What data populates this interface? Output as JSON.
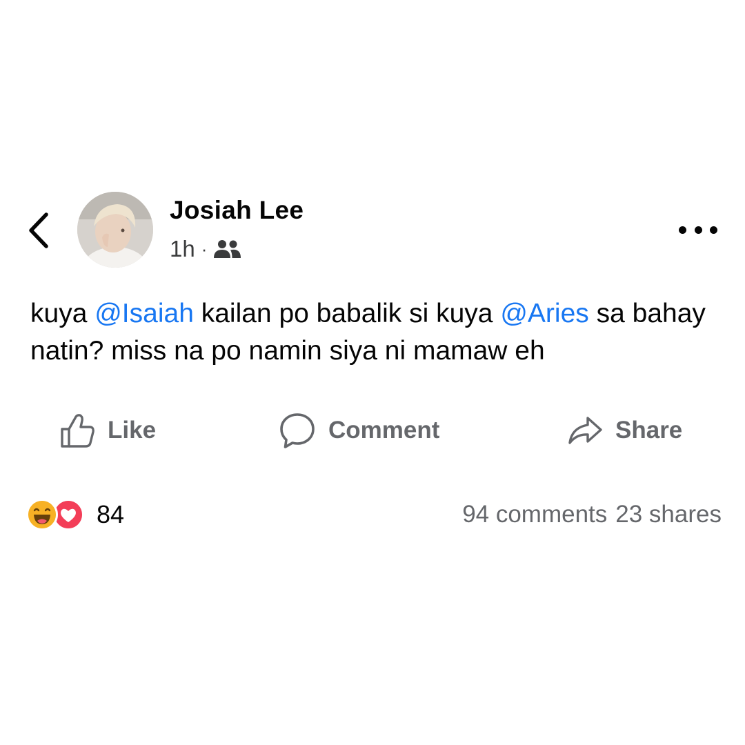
{
  "post": {
    "author": "Josiah Lee",
    "time": "1h",
    "separator": "·",
    "audience_icon": "friends-icon",
    "text_parts": {
      "t1": "kuya ",
      "m1": "@Isaiah",
      "t2": " kailan po babalik si kuya ",
      "m2": "@Aries",
      "t3": " sa bahay natin? miss na po namin siya ni mamaw eh"
    },
    "mention_color": "#1877f2"
  },
  "actions": {
    "like": "Like",
    "comment": "Comment",
    "share": "Share"
  },
  "reactions": {
    "types": [
      "haha",
      "love"
    ],
    "count": "84"
  },
  "stats": {
    "comments": "94 comments",
    "shares": "23 shares"
  },
  "icons": {
    "back": "chevron-left-icon",
    "more": "more-options-icon",
    "like": "thumbs-up-icon",
    "comment": "speech-bubble-icon",
    "share": "share-arrow-icon"
  },
  "colors": {
    "text": "#050505",
    "secondary": "#65676b",
    "haha": "#f7b125",
    "love": "#f33e58"
  }
}
